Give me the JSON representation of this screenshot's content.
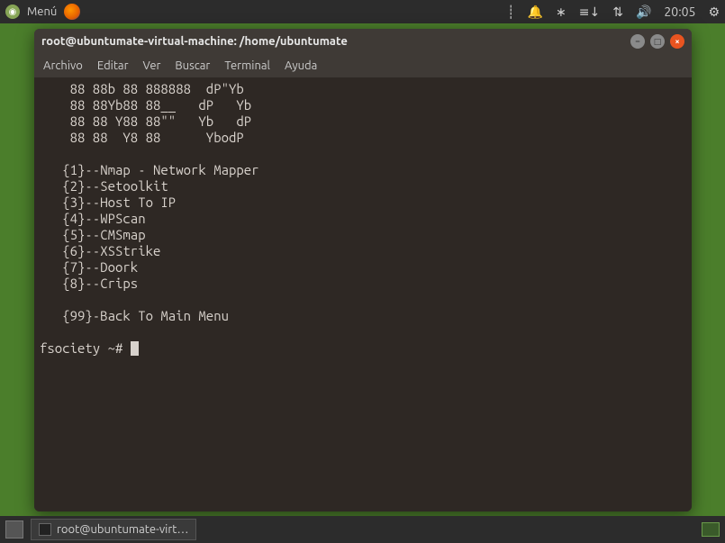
{
  "top_panel": {
    "menu_label": "Menú",
    "clock": "20:05"
  },
  "terminal": {
    "title": "root@ubuntumate-virtual-machine: /home/ubuntumate",
    "menu": {
      "file": "Archivo",
      "edit": "Editar",
      "view": "Ver",
      "search": "Buscar",
      "terminal": "Terminal",
      "help": "Ayuda"
    },
    "ascii": [
      "    88 88b 88 888888  dP\"Yb",
      "    88 88Yb88 88__   dP   Yb",
      "    88 88 Y88 88\"\"   Yb   dP",
      "    88 88  Y8 88      YbodP"
    ],
    "items": [
      "   {1}--Nmap - Network Mapper",
      "   {2}--Setoolkit",
      "   {3}--Host To IP",
      "   {4}--WPScan",
      "   {5}--CMSmap",
      "   {6}--XSStrike",
      "   {7}--Doork",
      "   {8}--Crips"
    ],
    "back": "   {99}-Back To Main Menu",
    "prompt": "fsociety ~# "
  },
  "bottom_panel": {
    "taskbar_item": "root@ubuntumate-virt…"
  }
}
